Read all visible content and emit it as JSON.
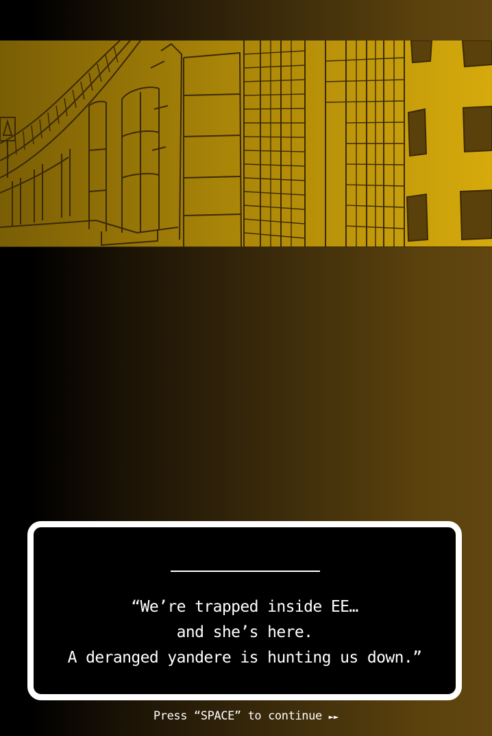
{
  "dialog": {
    "lines": [
      "“We’re trapped inside EE…",
      "and she’s here.",
      "A deranged yandere is hunting us down.”"
    ]
  },
  "prompt": {
    "text": "Press “SPACE” to continue",
    "arrows": "►►"
  },
  "colors": {
    "scene_ink": "#3b2906",
    "scene_gold_dark": "#8a6a05",
    "scene_gold_light": "#d4a80c",
    "dialog_border": "#ffffff",
    "dialog_bg": "#000000"
  },
  "icons": {
    "road_sign": "road-sign-icon",
    "continue": "double-arrow-right-icon"
  }
}
